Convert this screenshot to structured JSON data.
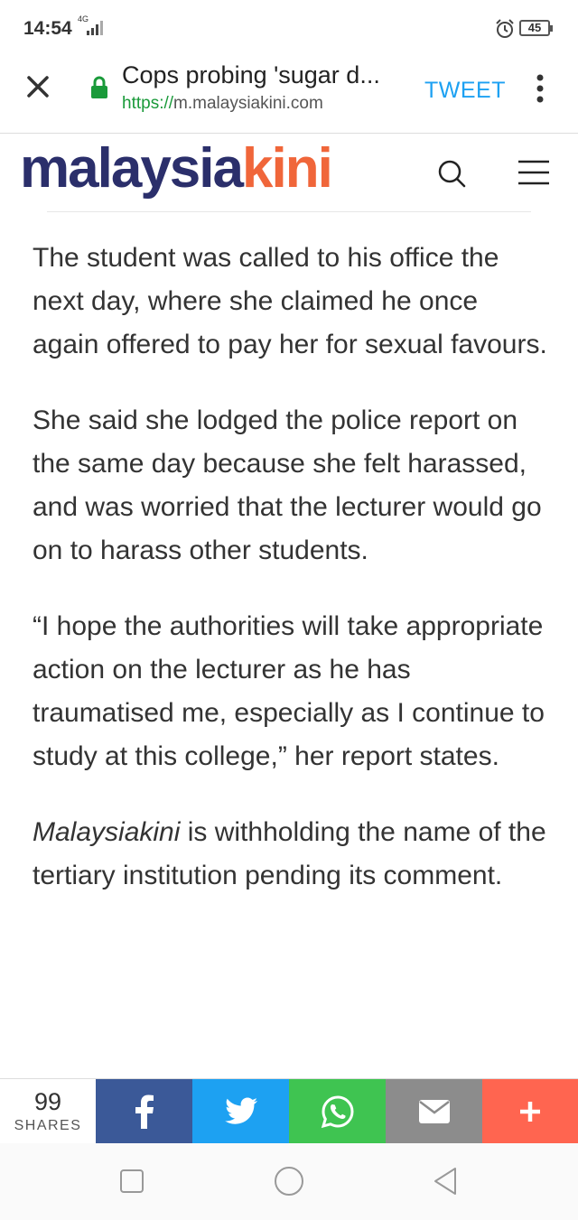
{
  "status_bar": {
    "time": "14:54",
    "network": "4G",
    "battery": "45",
    "icons": [
      "signal-icon",
      "alarm-icon",
      "battery-icon"
    ]
  },
  "browser": {
    "title": "Cops probing 'sugar d...",
    "url_scheme": "https://",
    "url_host": "m.malaysiakini.com",
    "tweet_label": "TWEET",
    "icons": [
      "close-icon",
      "lock-icon",
      "more-vert-icon"
    ],
    "lock_color": "#1a9a3a",
    "tweet_color": "#1da1f2"
  },
  "site": {
    "logo_part_a": "malaysia",
    "logo_part_b": "kini",
    "logo_color_a": "#2b2f6b",
    "logo_color_b": "#f0663a",
    "icons": [
      "search-icon",
      "hamburger-menu-icon"
    ]
  },
  "article": {
    "p1": "The student was called to his office the next day, where she claimed he once again offered to pay her for sexual favours.",
    "p2": "She said she lodged the police report on the same day because she felt harassed, and was worried that the lecturer would go on to harass other students.",
    "p3": "“I hope the authorities will take appropriate action on the lecturer as he has traumatised me, especially as I continue to study at this college,” her report states.",
    "p4_italic": "Malaysiakini",
    "p4_rest": " is withholding the name of the tertiary institution pending its comment."
  },
  "share": {
    "count": "99",
    "label": "SHARES",
    "buttons": [
      {
        "name": "facebook",
        "icon": "facebook-icon",
        "color": "#3b5998"
      },
      {
        "name": "twitter",
        "icon": "twitter-icon",
        "color": "#1da1f2"
      },
      {
        "name": "whatsapp",
        "icon": "whatsapp-icon",
        "color": "#3fc451"
      },
      {
        "name": "email",
        "icon": "email-icon",
        "color": "#8c8c8c"
      },
      {
        "name": "more",
        "icon": "plus-icon",
        "color": "#ff6550"
      }
    ]
  },
  "nav": {
    "icons": [
      "recents-square-icon",
      "home-circle-icon",
      "back-triangle-icon"
    ]
  }
}
